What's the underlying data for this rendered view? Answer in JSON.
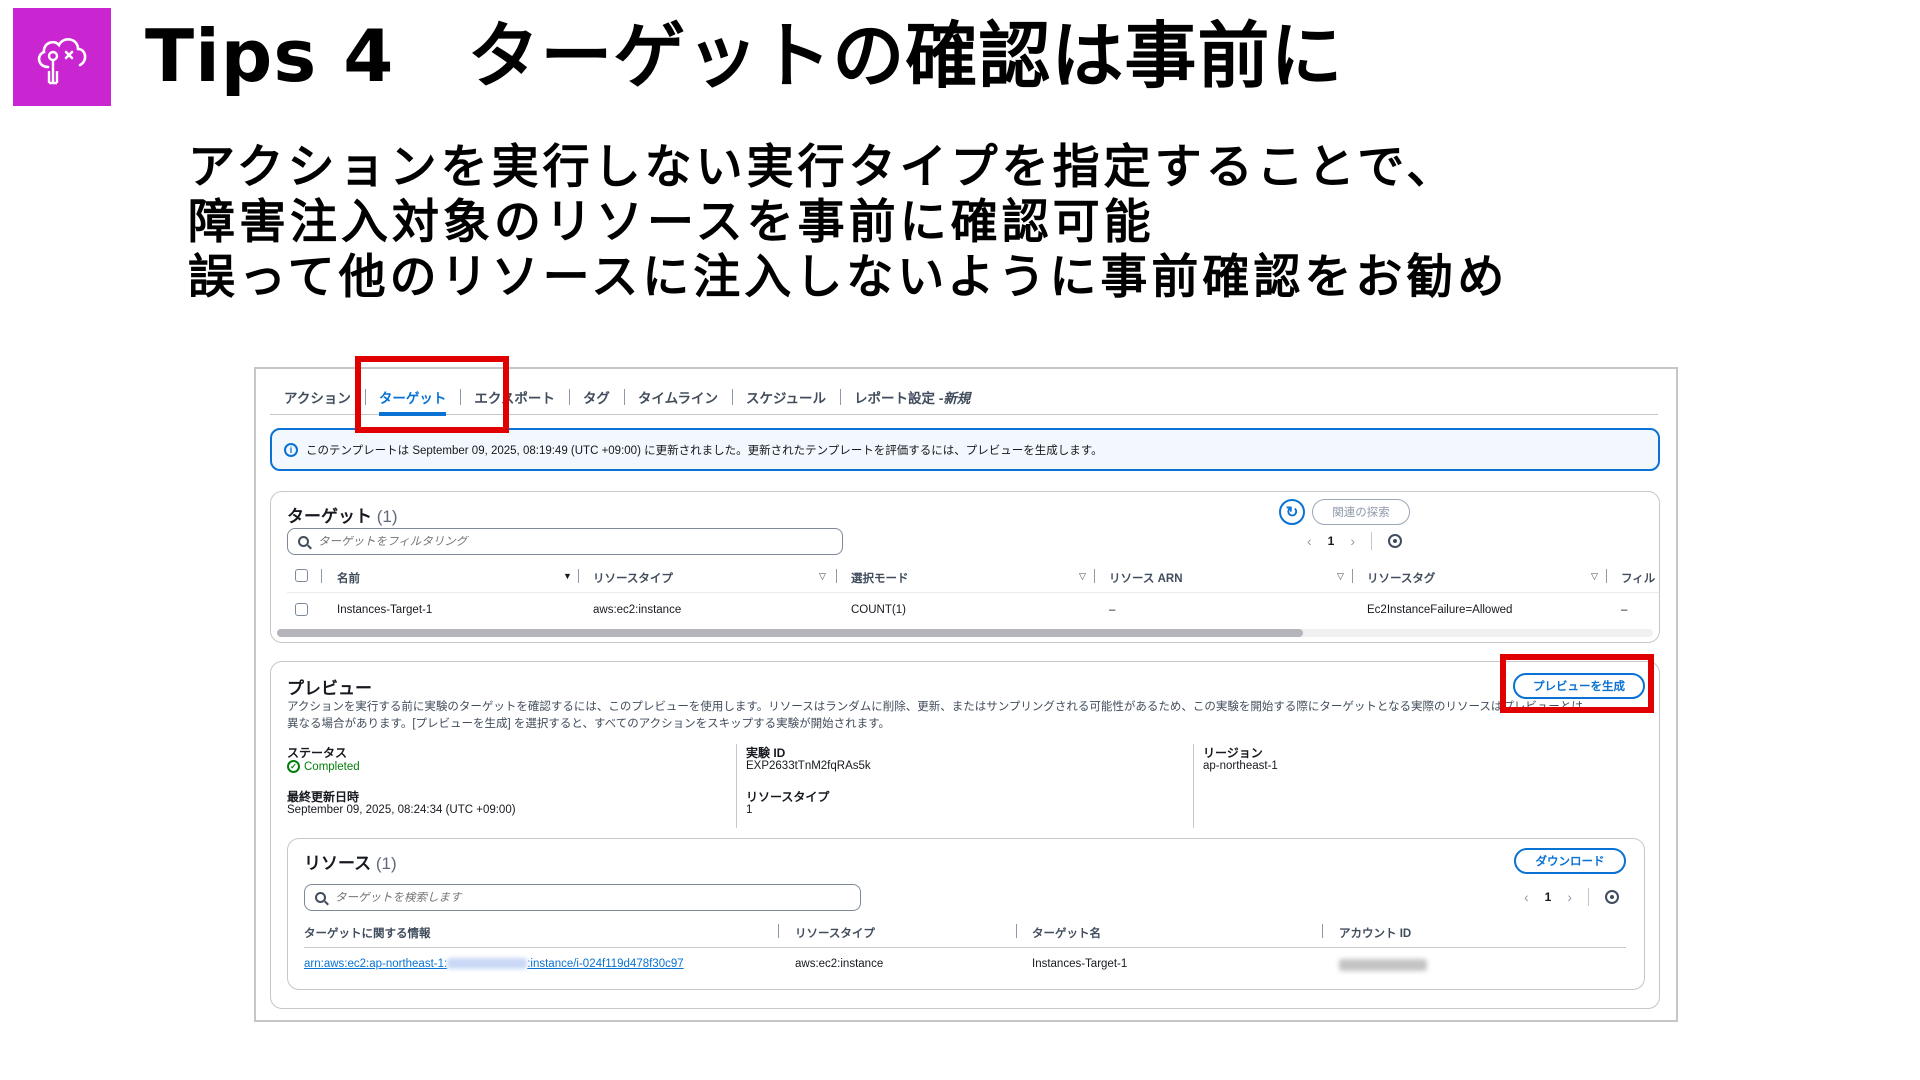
{
  "slide": {
    "title": "Tips 4　ターゲットの確認は事前に",
    "body_lines": [
      "アクションを実行しない実行タイプを指定することで、",
      "障害注入対象のリソースを事前に確認可能",
      "誤って他のリソースに注入しないように事前確認をお勧め"
    ],
    "logo_color": "#c925d1"
  },
  "tabs": [
    "アクション",
    "ターゲット",
    "エクスポート",
    "タグ",
    "タイムライン",
    "スケジュール",
    "レポート設定 - ",
    "新規"
  ],
  "info_bar": {
    "text": "このテンプレートは September 09, 2025, 08:19:49 (UTC +09:00) に更新されました。更新されたテンプレートを評価するには、プレビューを生成します。"
  },
  "targets": {
    "title": "ターゲット",
    "count": "(1)",
    "related_button": "関連の探索",
    "search_placeholder": "ターゲットをフィルタリング",
    "page": "1",
    "columns": [
      "名前",
      "リソースタイプ",
      "選択モード",
      "リソース ARN",
      "リソースタグ",
      "フィル"
    ],
    "rows": [
      {
        "name": "Instances-Target-1",
        "type": "aws:ec2:instance",
        "mode": "COUNT(1)",
        "arn": "–",
        "tag": "Ec2InstanceFailure=Allowed",
        "filter": "–"
      }
    ]
  },
  "preview": {
    "title": "プレビュー",
    "generate_button": "プレビューを生成",
    "description_line1": "アクションを実行する前に実験のターゲットを確認するには、このプレビューを使用します。リソースはランダムに削除、更新、またはサンプリングされる可能性があるため、この実験を開始する際にターゲットとなる実際のリソースはプレビューとは",
    "description_line2": "異なる場合があります。[プレビューを生成] を選択すると、すべてのアクションをスキップする実験が開始されます。",
    "status_label": "ステータス",
    "status_value": "Completed",
    "updated_label": "最終更新日時",
    "updated_value": "September 09, 2025, 08:24:34 (UTC +09:00)",
    "experiment_id_label": "実験 ID",
    "experiment_id_value": "EXP2633tTnM2fqRAs5k",
    "resource_type_label": "リソースタイプ",
    "resource_type_value": "1",
    "region_label": "リージョン",
    "region_value": "ap-northeast-1"
  },
  "resources": {
    "title": "リソース",
    "count": "(1)",
    "download_button": "ダウンロード",
    "search_placeholder": "ターゲットを検索します",
    "page": "1",
    "columns": [
      "ターゲットに関する情報",
      "リソースタイプ",
      "ターゲット名",
      "アカウント ID"
    ],
    "rows": [
      {
        "info_prefix": "arn:aws:ec2:ap-northeast-1:",
        "info_suffix": ":instance/i-024f119d478f30c97",
        "type": "aws:ec2:instance",
        "target_name": "Instances-Target-1"
      }
    ]
  },
  "colors": {
    "accent": "#0972d3",
    "highlight": "#e00000",
    "success": "#037f0c"
  }
}
